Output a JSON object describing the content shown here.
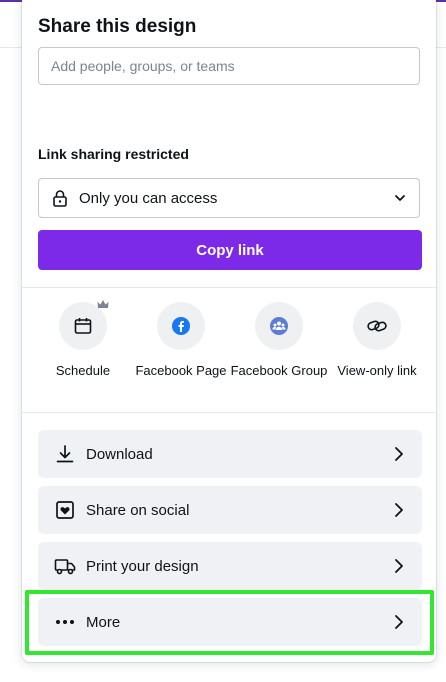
{
  "dialog": {
    "title": "Share this design",
    "people_placeholder": "Add people, groups, or teams",
    "link_section_label": "Link sharing restricted",
    "access_value": "Only you can access",
    "copy_link_label": "Copy link"
  },
  "share_options": [
    {
      "label": "Schedule",
      "icon": "calendar-icon",
      "premium": true
    },
    {
      "label": "Facebook Page",
      "icon": "facebook-icon"
    },
    {
      "label": "Facebook Group",
      "icon": "facebook-group-icon"
    },
    {
      "label": "View-only link",
      "icon": "link-icon"
    }
  ],
  "actions": [
    {
      "label": "Download",
      "icon": "download-icon"
    },
    {
      "label": "Share on social",
      "icon": "heart-icon"
    },
    {
      "label": "Print your design",
      "icon": "truck-icon"
    },
    {
      "label": "More",
      "icon": "more-icon",
      "highlighted": true
    }
  ],
  "colors": {
    "accent": "#7d2ae8",
    "highlight": "#32e632",
    "facebook": "#1877f2",
    "facebook_group": "#5e7bd6"
  }
}
